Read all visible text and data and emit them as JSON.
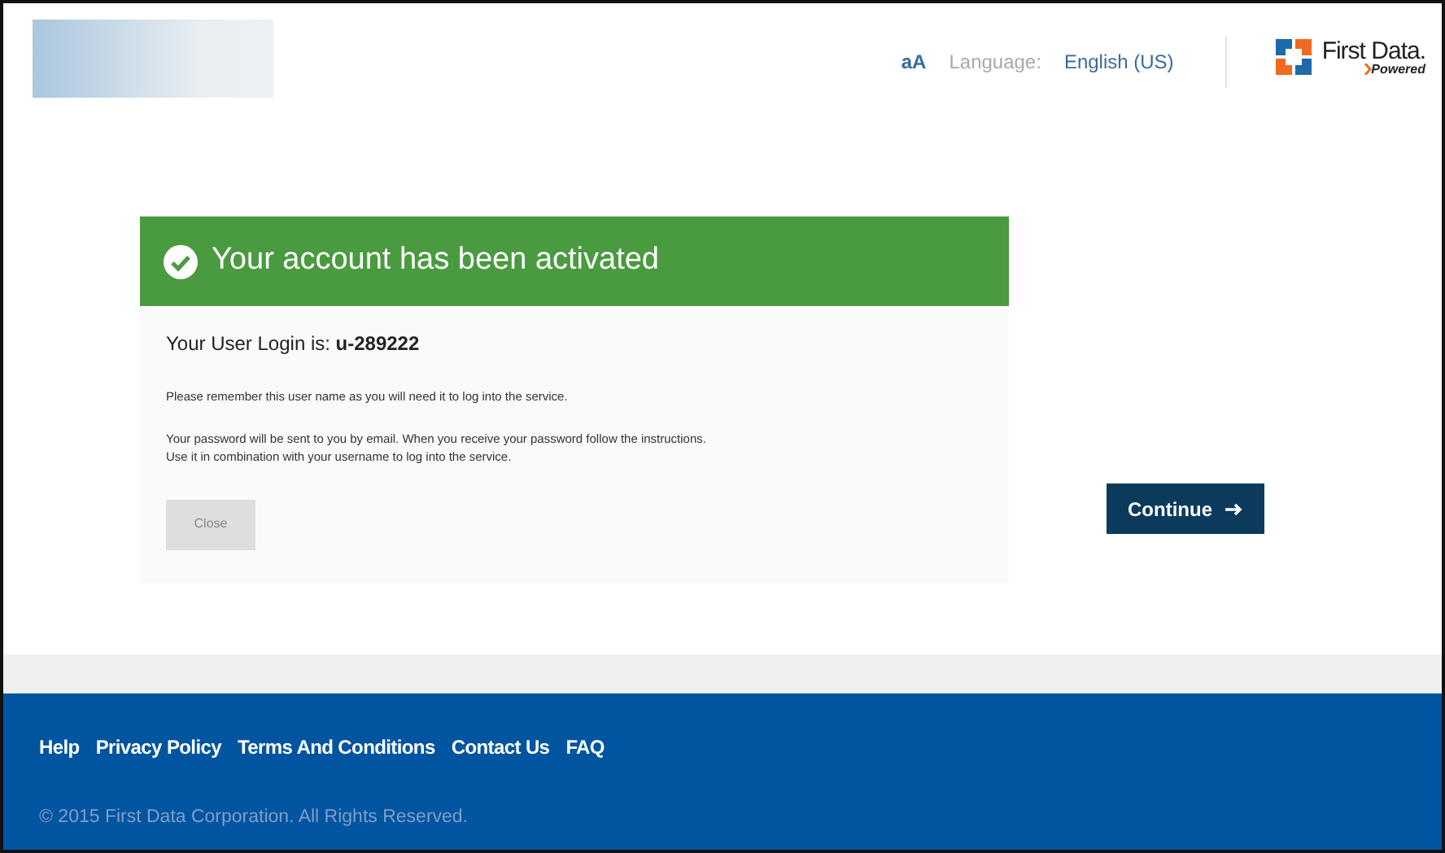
{
  "header": {
    "text_size": "aA",
    "language_label": "Language:",
    "language": "English (US)",
    "brand": {
      "name": "First Data.",
      "tagline": "Powered"
    }
  },
  "panel": {
    "title": "Your account has been activated",
    "login": "Your User Login is: **u-289222**",
    "paragraphs": [
      "Please remember this user name as you will need it to log into the service.",
      "Your password will be sent to you by email. When you receive your password follow the instructions.\n Use it in combination with your username to log into the service."
    ],
    "close": {
      "label": "Close",
      "disabled": true
    }
  },
  "continue": {
    "label": "Continue"
  },
  "footer": {
    "links": [
      "Help",
      "Privacy Policy",
      "Terms And Conditions",
      "Contact Us",
      "FAQ"
    ],
    "copyright": "© 2015 First Data Corporation. All Rights Reserved."
  }
}
